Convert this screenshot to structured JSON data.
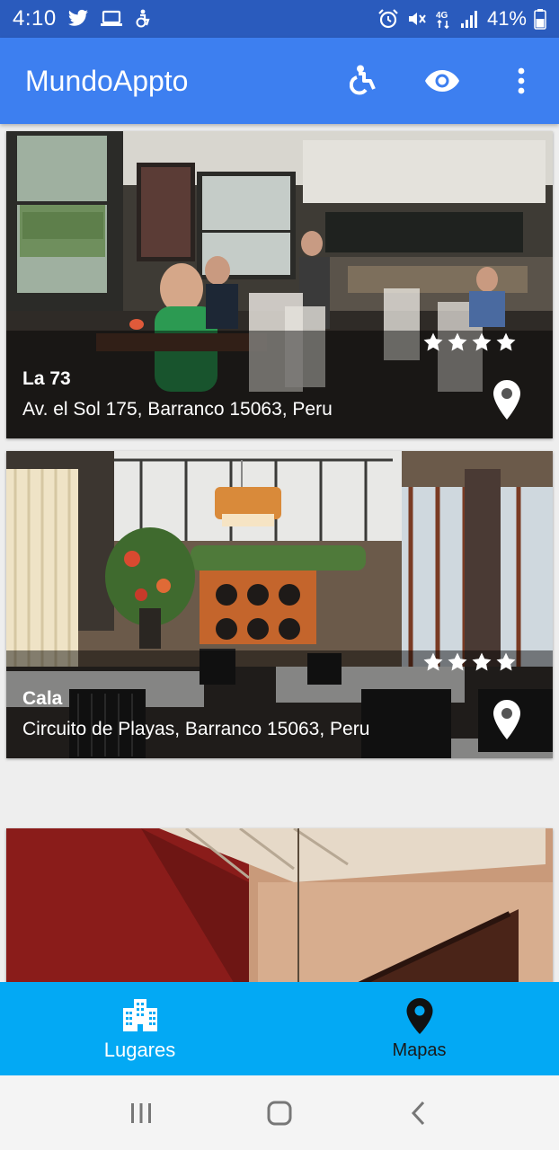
{
  "status_bar": {
    "time": "4:10",
    "battery": "41%",
    "left_icons": [
      "twitter-icon",
      "laptop-icon",
      "accessibility-icon"
    ],
    "right_icons": [
      "alarm-icon",
      "mute-icon",
      "4g-icon",
      "signal-icon",
      "battery-icon"
    ]
  },
  "app_bar": {
    "title": "MundoAppto",
    "actions": [
      "accessibility-icon",
      "eye-icon",
      "more-vert-icon"
    ],
    "color": "#3d7ff0"
  },
  "places": [
    {
      "name": "La 73",
      "address": "Av. el Sol 175, Barranco 15063, Peru",
      "rating": 4
    },
    {
      "name": "Cala",
      "address": "Circuito de Playas, Barranco 15063, Peru",
      "rating": 4
    }
  ],
  "bottom_nav": {
    "items": [
      {
        "label": "Lugares",
        "icon": "building-icon",
        "active": true
      },
      {
        "label": "Mapas",
        "icon": "map-pin-icon",
        "active": false
      }
    ],
    "color": "#03a9f4"
  },
  "system_nav": {
    "buttons": [
      "recents-icon",
      "home-icon",
      "back-icon"
    ]
  }
}
